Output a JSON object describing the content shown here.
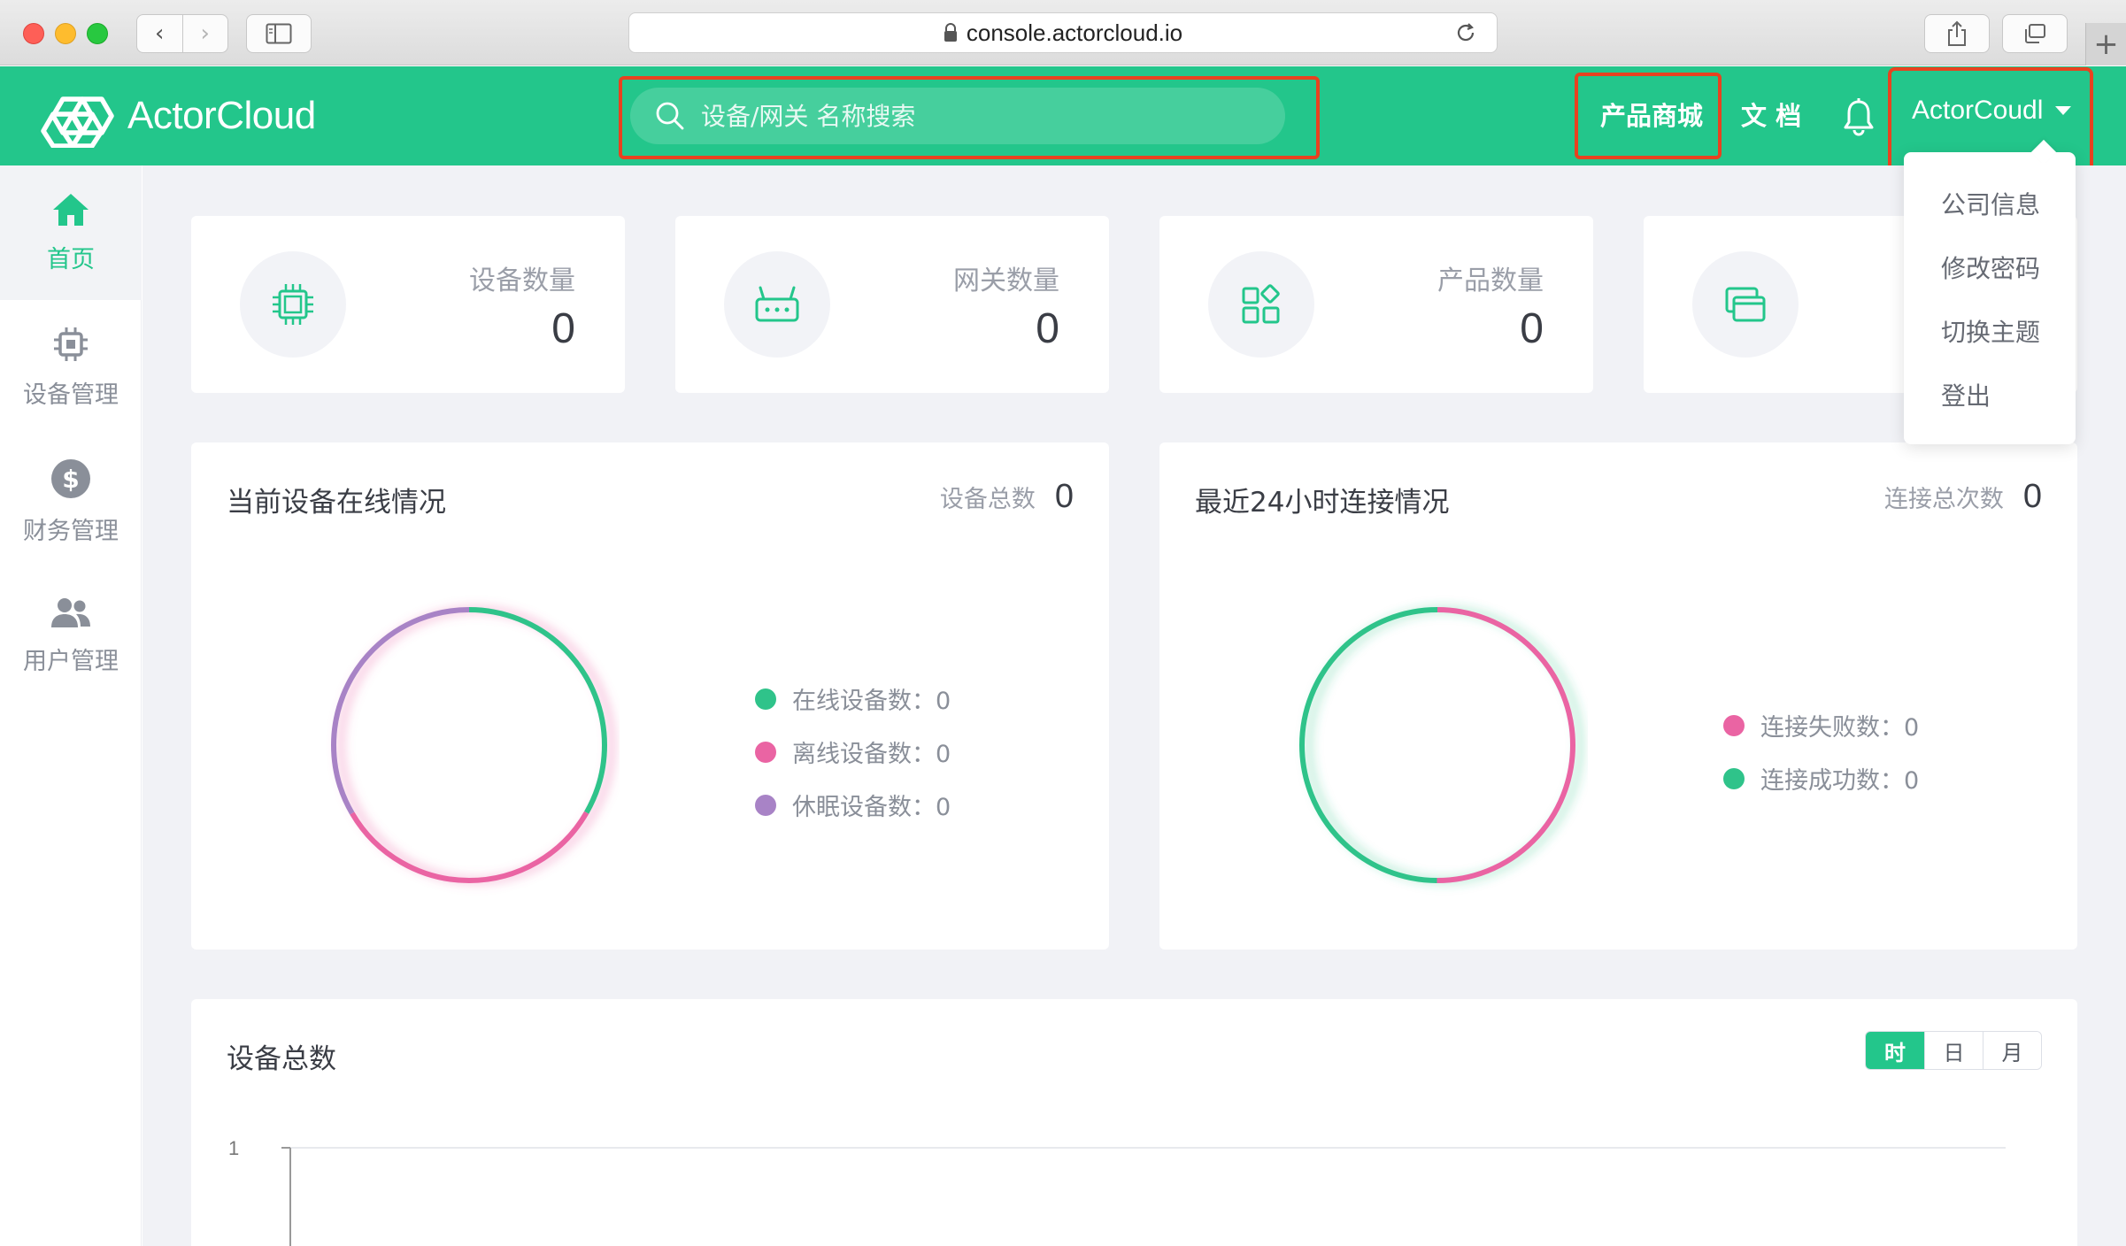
{
  "browser": {
    "url": "console.actorcloud.io",
    "back_glyph": "‹",
    "forward_glyph": "›",
    "new_tab_glyph": "+"
  },
  "header": {
    "brand": "ActorCloud",
    "search": {
      "placeholder": "设备/网关 名称搜索",
      "value": ""
    },
    "store_link": "产品商城",
    "docs_link": "文 档",
    "user_name": "ActorCoudl",
    "highlight_color": "#e8421f",
    "accent_color": "#23c68b"
  },
  "user_menu": {
    "items": [
      {
        "label": "公司信息"
      },
      {
        "label": "修改密码"
      },
      {
        "label": "切换主题"
      },
      {
        "label": "登出"
      }
    ]
  },
  "sidebar": {
    "items": [
      {
        "label": "首页",
        "icon": "home-icon",
        "active": true
      },
      {
        "label": "设备管理",
        "icon": "chip-icon",
        "active": false
      },
      {
        "label": "财务管理",
        "icon": "dollar-icon",
        "active": false
      },
      {
        "label": "用户管理",
        "icon": "users-icon",
        "active": false
      }
    ]
  },
  "stats": [
    {
      "label": "设备数量",
      "value": "0",
      "icon": "chip-icon"
    },
    {
      "label": "网关数量",
      "value": "0",
      "icon": "router-icon"
    },
    {
      "label": "产品数量",
      "value": "0",
      "icon": "apps-icon"
    },
    {
      "label": "",
      "value": "",
      "icon": "windows-icon"
    }
  ],
  "device_online": {
    "title": "当前设备在线情况",
    "total_label": "设备总数",
    "total_value": "0",
    "legend": [
      {
        "label": "在线设备数：0",
        "color": "#2fc38a"
      },
      {
        "label": "离线设备数：0",
        "color": "#ea64a3"
      },
      {
        "label": "休眠设备数：0",
        "color": "#a883c6"
      }
    ]
  },
  "connections_24h": {
    "title": "最近24小时连接情况",
    "total_label": "连接总次数",
    "total_value": "0",
    "legend": [
      {
        "label": "连接失败数：0",
        "color": "#ea64a3"
      },
      {
        "label": "连接成功数：0",
        "color": "#2fc38a"
      }
    ]
  },
  "device_total": {
    "title": "设备总数",
    "ranges": [
      {
        "label": "时",
        "active": true
      },
      {
        "label": "日",
        "active": false
      },
      {
        "label": "月",
        "active": false
      }
    ],
    "y_tick": "1"
  }
}
